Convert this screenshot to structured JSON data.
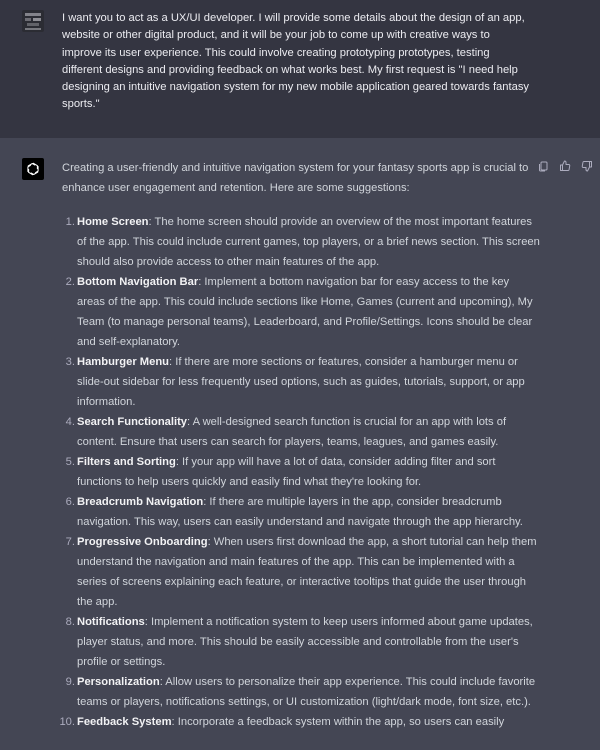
{
  "user_message": {
    "text": "I want you to act as a UX/UI developer. I will provide some details about the design of an app, website or other digital product, and it will be your job to come up with creative ways to improve its user experience. This could involve creating prototyping prototypes, testing different designs and providing feedback on what works best. My first request is \"I need help designing an intuitive navigation system for my new mobile application geared towards fantasy sports.\""
  },
  "assistant_message": {
    "intro": "Creating a user-friendly and intuitive navigation system for your fantasy sports app is crucial to enhance user engagement and retention. Here are some suggestions:",
    "points": [
      {
        "number": "1.",
        "title": "Home Screen",
        "text": ": The home screen should provide an overview of the most important features of the app. This could include current games, top players, or a brief news section. This screen should also provide access to other main features of the app."
      },
      {
        "number": "2.",
        "title": "Bottom Navigation Bar",
        "text": ": Implement a bottom navigation bar for easy access to the key areas of the app. This could include sections like Home, Games (current and upcoming), My Team (to manage personal teams), Leaderboard, and Profile/Settings. Icons should be clear and self-explanatory."
      },
      {
        "number": "3.",
        "title": "Hamburger Menu",
        "text": ": If there are more sections or features, consider a hamburger menu or slide-out sidebar for less frequently used options, such as guides, tutorials, support, or app information."
      },
      {
        "number": "4.",
        "title": "Search Functionality",
        "text": ": A well-designed search function is crucial for an app with lots of content. Ensure that users can search for players, teams, leagues, and games easily."
      },
      {
        "number": "5.",
        "title": "Filters and Sorting",
        "text": ": If your app will have a lot of data, consider adding filter and sort functions to help users quickly and easily find what they're looking for."
      },
      {
        "number": "6.",
        "title": "Breadcrumb Navigation",
        "text": ": If there are multiple layers in the app, consider breadcrumb navigation. This way, users can easily understand and navigate through the app hierarchy."
      },
      {
        "number": "7.",
        "title": "Progressive Onboarding",
        "text": ": When users first download the app, a short tutorial can help them understand the navigation and main features of the app. This can be implemented with a series of screens explaining each feature, or interactive tooltips that guide the user through the app."
      },
      {
        "number": "8.",
        "title": "Notifications",
        "text": ": Implement a notification system to keep users informed about game updates, player status, and more. This should be easily accessible and controllable from the user's profile or settings."
      },
      {
        "number": "9.",
        "title": "Personalization",
        "text": ": Allow users to personalize their app experience. This could include favorite teams or players, notifications settings, or UI customization (light/dark mode, font size, etc.)."
      },
      {
        "number": "10.",
        "title": "Feedback System",
        "text": ": Incorporate a feedback system within the app, so users can easily"
      }
    ]
  },
  "actions": [
    {
      "icon": "copy-icon"
    },
    {
      "icon": "thumbs-up-icon"
    },
    {
      "icon": "thumbs-down-icon"
    }
  ],
  "colors": {
    "user_bg": "#343541",
    "assistant_bg": "#444654",
    "text": "#d1d5db",
    "gpt_avatar_bg": "#000000"
  }
}
